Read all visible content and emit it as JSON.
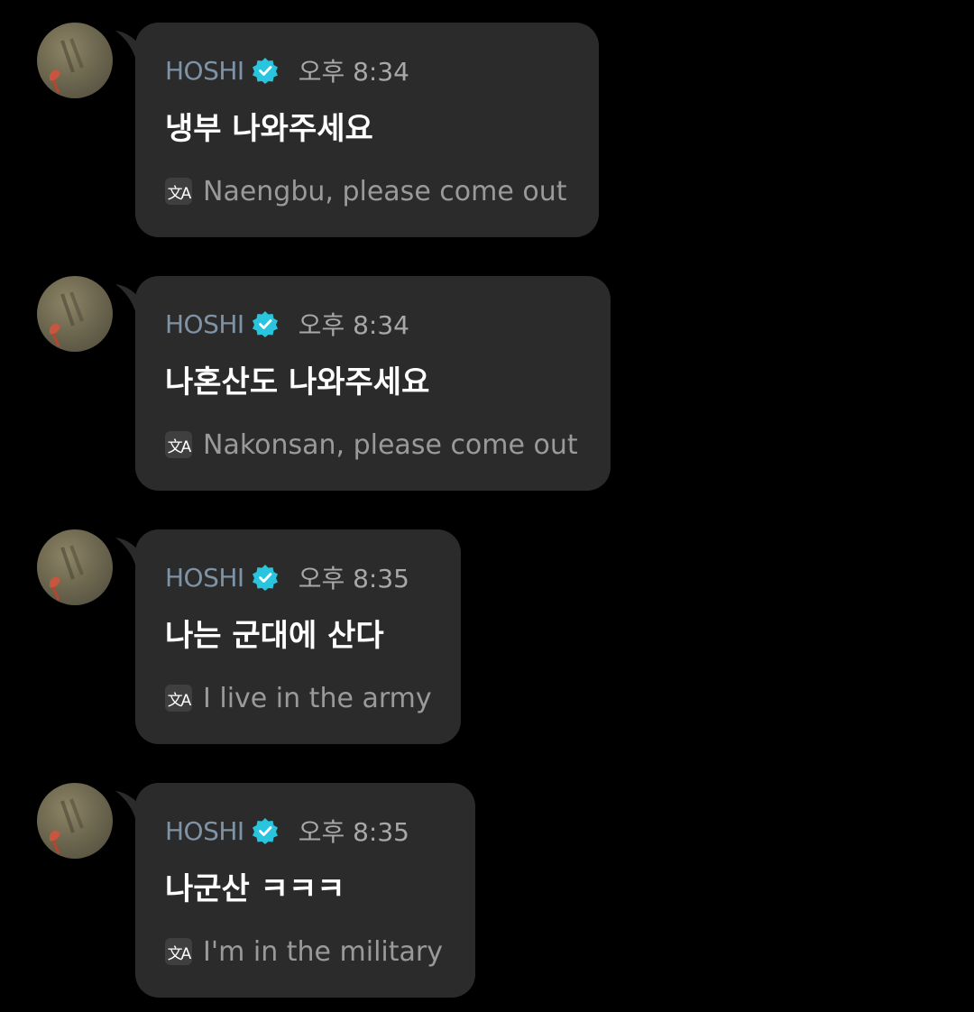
{
  "messages": [
    {
      "sender": "HOSHI",
      "time": "오후 8:34",
      "text": "냉부 나와주세요",
      "translation": "Naengbu, please come out"
    },
    {
      "sender": "HOSHI",
      "time": "오후 8:34",
      "text": "나혼산도 나와주세요",
      "translation": "Nakonsan, please come out"
    },
    {
      "sender": "HOSHI",
      "time": "오후 8:35",
      "text": "나는 군대에 산다",
      "translation": "I live in the army"
    },
    {
      "sender": "HOSHI",
      "time": "오후 8:35",
      "text": "나군산 ㅋㅋㅋ",
      "translation": "I'm in the military"
    }
  ],
  "icons": {
    "verified": "verified-badge-icon",
    "translate": "translate-icon"
  },
  "colors": {
    "background": "#000000",
    "bubble": "#2b2b2b",
    "sender_name": "#7f93a6",
    "verified_badge": "#29c4dd",
    "message_text": "#ffffff",
    "translation_text": "#9a9a9a"
  }
}
